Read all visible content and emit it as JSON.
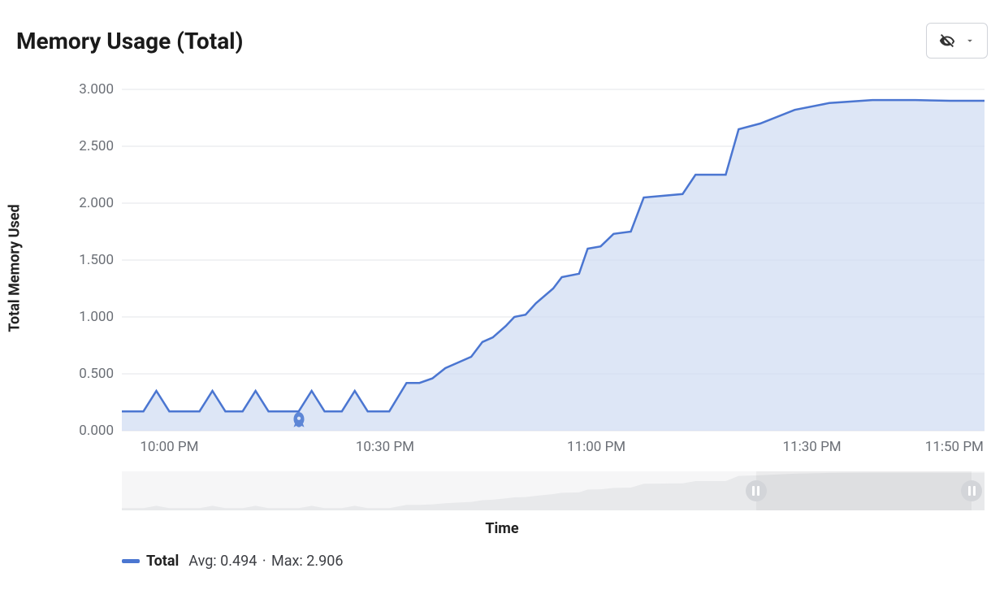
{
  "header": {
    "title": "Memory Usage (Total)"
  },
  "axes": {
    "y_title": "Total Memory Used",
    "x_title": "Time"
  },
  "legend": {
    "series_name": "Total",
    "avg_label": "Avg:",
    "avg_value": "0.494",
    "sep": "·",
    "max_label": "Max:",
    "max_value": "2.906"
  },
  "chart_data": {
    "type": "area",
    "title": "Memory Usage (Total)",
    "xlabel": "Time",
    "ylabel": "Total Memory Used",
    "ylim": [
      0,
      3.0
    ],
    "y_ticks": [
      "0.000",
      "0.500",
      "1.000",
      "1.500",
      "2.000",
      "2.500",
      "3.000"
    ],
    "x_ticks": [
      {
        "pos": 0.055,
        "label": "10:00 PM"
      },
      {
        "pos": 0.305,
        "label": "10:30 PM"
      },
      {
        "pos": 0.55,
        "label": "11:00 PM"
      },
      {
        "pos": 0.8,
        "label": "11:30 PM"
      },
      {
        "pos": 0.965,
        "label": "11:50 PM"
      }
    ],
    "series": [
      {
        "name": "Total",
        "color": "#4b76d1",
        "avg": 0.494,
        "max": 2.906,
        "points": [
          {
            "t": 0.0,
            "v": 0.17
          },
          {
            "t": 0.025,
            "v": 0.17
          },
          {
            "t": 0.04,
            "v": 0.35
          },
          {
            "t": 0.055,
            "v": 0.17
          },
          {
            "t": 0.09,
            "v": 0.17
          },
          {
            "t": 0.105,
            "v": 0.35
          },
          {
            "t": 0.12,
            "v": 0.17
          },
          {
            "t": 0.14,
            "v": 0.17
          },
          {
            "t": 0.155,
            "v": 0.35
          },
          {
            "t": 0.17,
            "v": 0.17
          },
          {
            "t": 0.205,
            "v": 0.17
          },
          {
            "t": 0.22,
            "v": 0.35
          },
          {
            "t": 0.235,
            "v": 0.17
          },
          {
            "t": 0.255,
            "v": 0.17
          },
          {
            "t": 0.27,
            "v": 0.35
          },
          {
            "t": 0.285,
            "v": 0.17
          },
          {
            "t": 0.31,
            "v": 0.17
          },
          {
            "t": 0.33,
            "v": 0.42
          },
          {
            "t": 0.345,
            "v": 0.42
          },
          {
            "t": 0.36,
            "v": 0.46
          },
          {
            "t": 0.375,
            "v": 0.55
          },
          {
            "t": 0.39,
            "v": 0.6
          },
          {
            "t": 0.405,
            "v": 0.65
          },
          {
            "t": 0.418,
            "v": 0.78
          },
          {
            "t": 0.43,
            "v": 0.82
          },
          {
            "t": 0.445,
            "v": 0.92
          },
          {
            "t": 0.455,
            "v": 1.0
          },
          {
            "t": 0.468,
            "v": 1.02
          },
          {
            "t": 0.48,
            "v": 1.12
          },
          {
            "t": 0.5,
            "v": 1.25
          },
          {
            "t": 0.51,
            "v": 1.35
          },
          {
            "t": 0.53,
            "v": 1.38
          },
          {
            "t": 0.54,
            "v": 1.6
          },
          {
            "t": 0.555,
            "v": 1.62
          },
          {
            "t": 0.57,
            "v": 1.73
          },
          {
            "t": 0.59,
            "v": 1.75
          },
          {
            "t": 0.605,
            "v": 2.05
          },
          {
            "t": 0.65,
            "v": 2.08
          },
          {
            "t": 0.665,
            "v": 2.25
          },
          {
            "t": 0.7,
            "v": 2.25
          },
          {
            "t": 0.715,
            "v": 2.65
          },
          {
            "t": 0.74,
            "v": 2.7
          },
          {
            "t": 0.78,
            "v": 2.82
          },
          {
            "t": 0.82,
            "v": 2.88
          },
          {
            "t": 0.87,
            "v": 2.906
          },
          {
            "t": 0.92,
            "v": 2.906
          },
          {
            "t": 0.96,
            "v": 2.9
          },
          {
            "t": 1.0,
            "v": 2.9
          }
        ]
      }
    ],
    "annotations": [
      {
        "type": "rocket-icon",
        "t": 0.205,
        "v": 0.0
      }
    ],
    "scrubber": {
      "window": {
        "start": 0.735,
        "end": 0.985
      }
    }
  }
}
